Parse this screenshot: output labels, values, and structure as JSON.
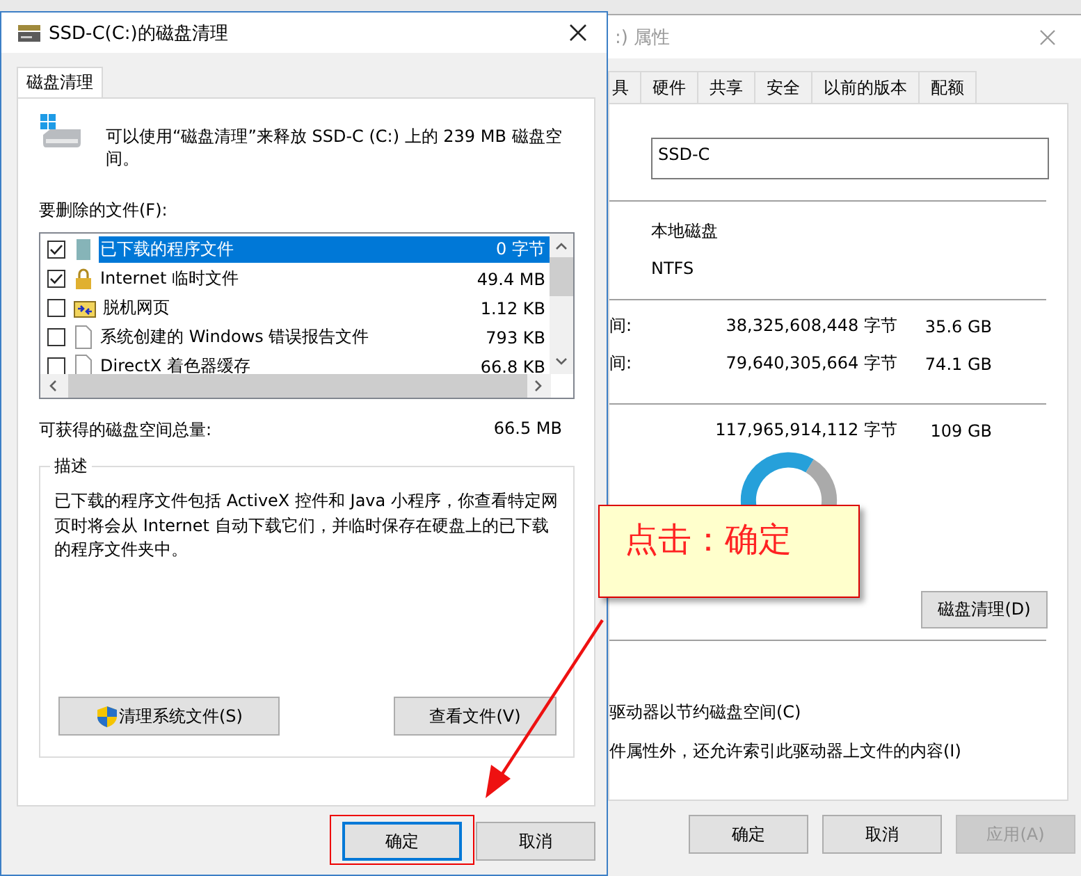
{
  "cleanup_window": {
    "title": "SSD-C(C:)的磁盘清理",
    "tabs": [
      {
        "label": "磁盘清理",
        "selected": true
      }
    ],
    "message": "可以使用“磁盘清理”来释放 SSD-C (C:) 上的 239 MB 磁盘空间。",
    "files_label": "要删除的文件(F):",
    "files": [
      {
        "kind": "package",
        "name": "已下载的程序文件",
        "size": "0 字节",
        "checked": true,
        "selected": true
      },
      {
        "kind": "lock",
        "name": "Internet 临时文件",
        "size": "49.4 MB",
        "checked": true,
        "selected": false
      },
      {
        "kind": "web",
        "name": "脱机网页",
        "size": "1.12 KB",
        "checked": false,
        "selected": false
      },
      {
        "kind": "document",
        "name": "系统创建的 Windows 错误报告文件",
        "size": "793 KB",
        "checked": false,
        "selected": false
      },
      {
        "kind": "document",
        "name": "DirectX 着色器缓存",
        "size": "66.8 KB",
        "checked": false,
        "selected": false
      }
    ],
    "total_label": "可获得的磁盘空间总量:",
    "total_value": "66.5 MB",
    "description": {
      "title": "描述",
      "text": "已下载的程序文件包括 ActiveX 控件和 Java 小程序，你查看特定网页时将会从 Internet 自动下载它们，并临时保存在硬盘上的已下载的程序文件夹中。"
    },
    "actions": [
      {
        "label": "清理系统文件(S)",
        "shield": true
      },
      {
        "label": "查看文件(V)",
        "shield": false
      }
    ],
    "buttons": [
      {
        "label": "确定",
        "default": true
      },
      {
        "label": "取消",
        "default": false
      }
    ]
  },
  "properties_window": {
    "title": ":) 属性",
    "tabs": [
      {
        "label": "具",
        "selected": false
      },
      {
        "label": "硬件",
        "selected": false
      },
      {
        "label": "共享",
        "selected": false
      },
      {
        "label": "安全",
        "selected": false
      },
      {
        "label": "以前的版本",
        "selected": false
      },
      {
        "label": "配额",
        "selected": false
      }
    ],
    "name_value": "SSD-C",
    "type_value": "本地磁盘",
    "filesystem_value": "NTFS",
    "space_rows": [
      {
        "label": "间:",
        "bytes": "38,325,608,448 字节",
        "size": "35.6 GB"
      },
      {
        "label": "间:",
        "bytes": "79,640,305,664 字节",
        "size": "74.1 GB"
      }
    ],
    "capacity": {
      "bytes": "117,965,914,112 字节",
      "size": "109 GB"
    },
    "cleanup_button": "磁盘清理(D)",
    "options": [
      "驱动器以节约磁盘空间(C)",
      "件属性外，还允许索引此驱动器上文件的内容(I)"
    ],
    "buttons": [
      {
        "label": "确定",
        "disabled": false
      },
      {
        "label": "取消",
        "disabled": false
      },
      {
        "label": "应用(A)",
        "disabled": true
      }
    ]
  },
  "callout": {
    "text": "点击：确定"
  }
}
